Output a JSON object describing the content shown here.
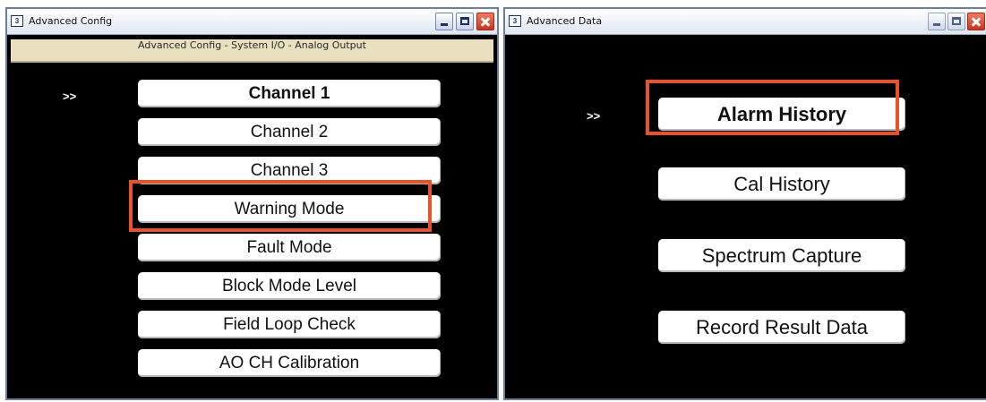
{
  "left_window": {
    "title": "Advanced Config",
    "icon": "app-window-icon",
    "header": "Advanced Config - System I/O - Analog Output",
    "pointer": ">>",
    "items": [
      {
        "label": "Channel 1"
      },
      {
        "label": "Channel 2"
      },
      {
        "label": "Channel 3"
      },
      {
        "label": "Warning Mode"
      },
      {
        "label": "Fault Mode"
      },
      {
        "label": "Block Mode Level"
      },
      {
        "label": "Field Loop Check"
      },
      {
        "label": "AO CH Calibration"
      }
    ],
    "selected_index": 0,
    "highlighted_item": "Warning Mode"
  },
  "right_window": {
    "title": "Advanced Data",
    "icon": "app-window-icon",
    "pointer": ">>",
    "items": [
      {
        "label": "Alarm History"
      },
      {
        "label": "Cal History"
      },
      {
        "label": "Spectrum Capture"
      },
      {
        "label": "Record Result Data"
      }
    ],
    "selected_index": 0,
    "highlighted_item": "Alarm History"
  },
  "colors": {
    "screen_background": "#000000",
    "header_band": "#e8e0bf",
    "button_face": "#ffffff",
    "highlight_outline": "#e8522a",
    "close_button": "#c9341e"
  }
}
